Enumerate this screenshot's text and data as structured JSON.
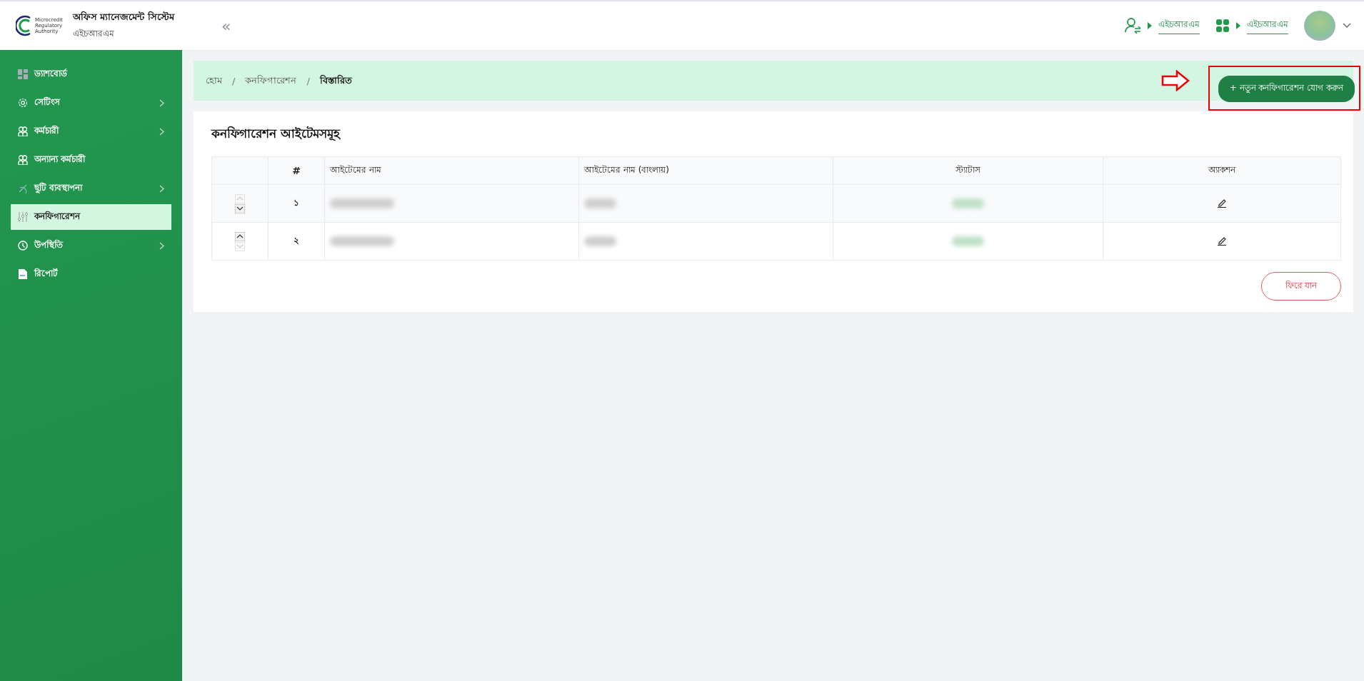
{
  "header": {
    "logo_lines": [
      "Microcredit",
      "Regulatory",
      "Authority"
    ],
    "app_title": "অফিস ম্যানেজমেন্ট সিস্টেম",
    "app_subtitle": "এইচআরএম",
    "collapse_glyph": "«",
    "links": [
      {
        "kind": "switch-user",
        "label": "এইচআরএম"
      },
      {
        "kind": "apps",
        "label": "এইচআরএম"
      }
    ]
  },
  "sidebar": {
    "items": [
      {
        "kind": "dashboard",
        "label": "ড্যাশবোর্ড",
        "has_submenu": false,
        "selected": false
      },
      {
        "kind": "settings",
        "label": "সেটিংস",
        "has_submenu": true,
        "selected": false
      },
      {
        "kind": "people",
        "label": "কর্মচারী",
        "has_submenu": true,
        "selected": false
      },
      {
        "kind": "people",
        "label": "অন্যান্য কর্মচারী",
        "has_submenu": false,
        "selected": false
      },
      {
        "kind": "leave",
        "label": "ছুটি ব্যবস্থাপনা",
        "has_submenu": true,
        "selected": false
      },
      {
        "kind": "config",
        "label": "কনফিগারেশন",
        "has_submenu": false,
        "selected": true
      },
      {
        "kind": "clock",
        "label": "উপস্থিতি",
        "has_submenu": true,
        "selected": false
      },
      {
        "kind": "report",
        "label": "রিপোর্ট",
        "has_submenu": false,
        "selected": false
      }
    ]
  },
  "breadcrumb_separator": "/",
  "breadcrumb": [
    {
      "label": "হোম",
      "current": false
    },
    {
      "label": "কনফিগারেশন",
      "current": false
    },
    {
      "label": "বিস্তারিত",
      "current": true
    }
  ],
  "add_button": {
    "label": "+ নতুন কনফিগারেশন যোগ করুন",
    "highlighted": true
  },
  "card": {
    "title": "কনফিগারেশন আইটেমসমূহ",
    "table": {
      "columns": [
        "",
        "#",
        "আইটেমের নাম",
        "আইটেমের নাম (বাংলায়)",
        "স্ট্যাটাস",
        "অ্যাকশন"
      ],
      "rows": [
        {
          "index": "১",
          "up_disabled": true,
          "down_disabled": false
        },
        {
          "index": "২",
          "up_disabled": false,
          "down_disabled": true
        }
      ]
    },
    "back_button": "ফিরে যান"
  }
}
